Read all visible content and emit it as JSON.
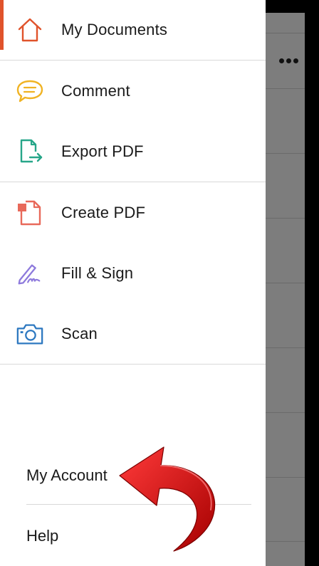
{
  "menu": {
    "items": [
      {
        "label": "My Documents",
        "icon": "home-icon"
      },
      {
        "label": "Comment",
        "icon": "comment-icon"
      },
      {
        "label": "Export PDF",
        "icon": "export-pdf-icon"
      },
      {
        "label": "Create PDF",
        "icon": "create-pdf-icon"
      },
      {
        "label": "Fill & Sign",
        "icon": "fill-sign-icon"
      },
      {
        "label": "Scan",
        "icon": "camera-icon"
      }
    ],
    "account_label": "My Account",
    "help_label": "Help"
  },
  "colors": {
    "accent": "#e0532b",
    "comment": "#f0b323",
    "export": "#27a689",
    "create": "#e8695a",
    "fill_sign": "#8d79dc",
    "scan": "#2d78c0",
    "annotation_arrow": "#d60f0f"
  }
}
